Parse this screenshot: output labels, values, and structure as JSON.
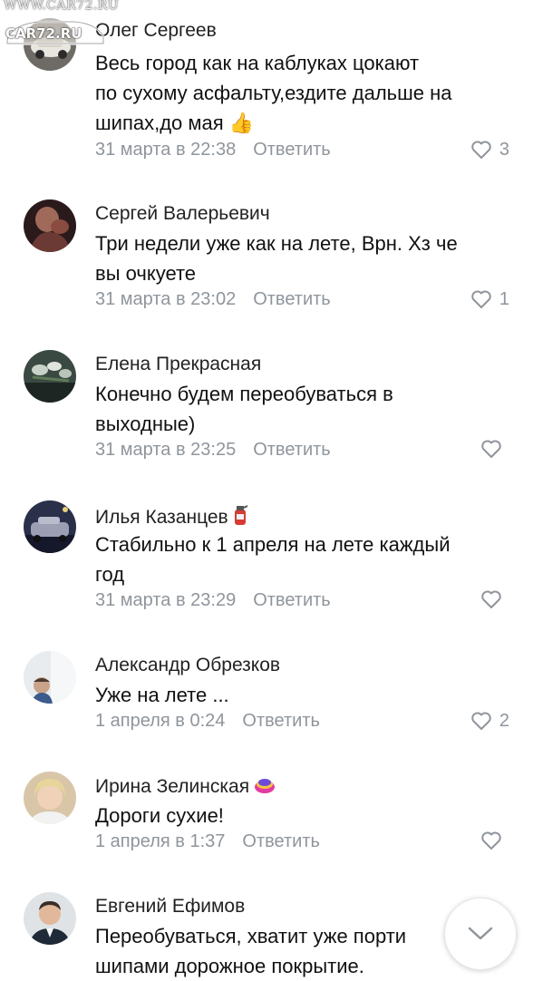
{
  "watermark": {
    "url": "WWW.CAR72.RU",
    "logo": "CAR72.RU"
  },
  "reply_label": "Ответить",
  "comments": [
    {
      "author": "Олег Сергеев",
      "text": "Весь город как на каблуках цокают\nпо сухому асфальту,ездите дальше на\nшипах,до мая 👍",
      "date": "31 марта в 22:38",
      "likes": "3",
      "avatar_icon": "car-photo"
    },
    {
      "author": "Сергей Валерьевич",
      "text": "Три недели уже как на лете, Врн. Хз че\nвы очкуете",
      "date": "31 марта в 23:02",
      "likes": "1",
      "avatar_icon": "person-photo"
    },
    {
      "author": "Елена Прекрасная",
      "text": "Конечно будем переобуваться в\nвыходные)",
      "date": "31 марта в 23:25",
      "likes": "",
      "avatar_icon": "flowers-photo"
    },
    {
      "author": "Илья Казанцев",
      "text": "Стабильно к 1 апреля на лете каждый\nгод",
      "date": "31 марта в 23:29",
      "likes": "",
      "avatar_icon": "car-photo",
      "badge_icon": "fire-extinguisher-icon"
    },
    {
      "author": "Александр Обрезков",
      "text": "Уже на лете ...",
      "date": "1 апреля в 0:24",
      "likes": "2",
      "avatar_icon": "person-photo"
    },
    {
      "author": "Ирина Зелинская",
      "text": "Дороги сухие!",
      "date": "1 апреля в 1:37",
      "likes": "",
      "avatar_icon": "person-photo",
      "badge_icon": "sticker-icon"
    },
    {
      "author": "Евгений Ефимов",
      "text": "Переобуваться, хватит уже порти\nшипами дорожное покрытие.",
      "date": "",
      "likes": "",
      "avatar_icon": "person-photo"
    }
  ],
  "colors": {
    "meta": "#8f959c",
    "text": "#111111",
    "author": "#222222"
  },
  "scroll_button_icon": "chevron-down-icon"
}
